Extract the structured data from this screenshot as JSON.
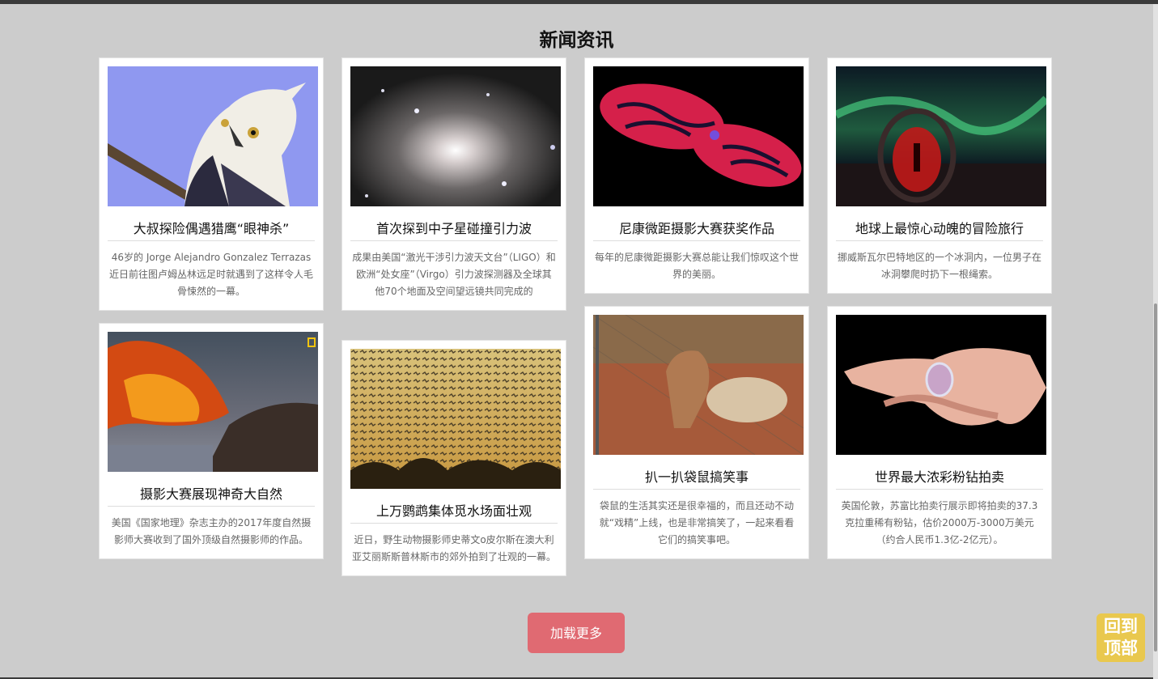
{
  "section_title": "新闻资讯",
  "cards": [
    {
      "title": "大叔探险偶遇猎鹰“眼神杀”",
      "desc": "46岁的 Jorge Alejandro Gonzalez Terrazas 近日前往图卢姆丛林远足时就遇到了这样令人毛骨悚然的一幕。",
      "image": "eagle-photo"
    },
    {
      "title": "首次探到中子星碰撞引力波",
      "desc": "成果由美国“激光干涉引力波天文台”（LIGO）和欧洲“处女座”（Virgo）引力波探测器及全球其他70个地面及空间望远镜共同完成的",
      "image": "galaxy-photo"
    },
    {
      "title": "尼康微距摄影大赛获奖作品",
      "desc": "每年的尼康微距摄影大赛总能让我们惊叹这个世界的美丽。",
      "image": "micro-photo"
    },
    {
      "title": "地球上最惊心动魄的冒险旅行",
      "desc": "挪威斯瓦尔巴特地区的一个冰洞内，一位男子在冰洞攀爬时扔下一根绳索。",
      "image": "aurora-photo"
    },
    {
      "title": "摄影大赛展现神奇大自然",
      "desc": "美国《国家地理》杂志主办的2017年度自然摄影师大赛收到了国外顶级自然摄影师的作品。",
      "image": "volcano-photo"
    },
    {
      "title": "上万鹦鹉集体觅水场面壮观",
      "desc": "近日，野生动物摄影师史蒂文o皮尔斯在澳大利亚艾丽斯斯普林斯市的郊外拍到了壮观的一幕。",
      "image": "parrots-photo"
    },
    {
      "title": "扒一扒袋鼠搞笑事",
      "desc": "袋鼠的生活其实还是很幸福的，而且还动不动就“戏精”上线，也是非常搞笑了，一起来看看它们的搞笑事吧。",
      "image": "kangaroo-photo"
    },
    {
      "title": "世界最大浓彩粉钻拍卖",
      "desc": "英国伦敦，苏富比拍卖行展示即将拍卖的37.3克拉重稀有粉钻，估价2000万-3000万美元（约合人民币1.3亿-2亿元）。",
      "image": "ring-photo"
    }
  ],
  "load_more_label": "加载更多",
  "back_to_top_label_line1": "回到",
  "back_to_top_label_line2": "顶部",
  "colors": {
    "background": "#cccccc",
    "load_more": "#e06a72",
    "back_to_top": "#e9c84e"
  }
}
